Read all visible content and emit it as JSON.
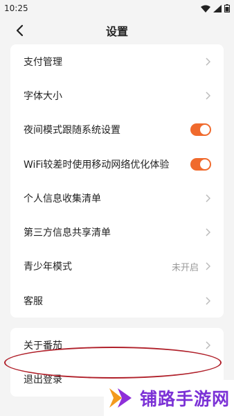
{
  "status_bar": {
    "time": "10:25"
  },
  "header": {
    "title": "设置"
  },
  "settings_group_1": [
    {
      "label": "支付管理",
      "control": "chevron"
    },
    {
      "label": "字体大小",
      "control": "chevron"
    },
    {
      "label": "夜间模式跟随系统设置",
      "control": "toggle",
      "on": true
    },
    {
      "label": "WiFi较差时使用移动网络优化体验",
      "control": "toggle",
      "on": true
    },
    {
      "label": "个人信息收集清单",
      "control": "chevron"
    },
    {
      "label": "第三方信息共享清单",
      "control": "chevron"
    },
    {
      "label": "青少年模式",
      "control": "chevron",
      "value": "未开启"
    },
    {
      "label": "客服",
      "control": "chevron"
    }
  ],
  "settings_group_2": [
    {
      "label": "关于番茄",
      "control": "chevron"
    },
    {
      "label": "退出登录",
      "control": "none"
    }
  ],
  "watermark": {
    "text": "铺路手游网"
  },
  "colors": {
    "accent": "#f06a2d",
    "highlight": "#b0202a",
    "watermark": "#7b31d6"
  }
}
